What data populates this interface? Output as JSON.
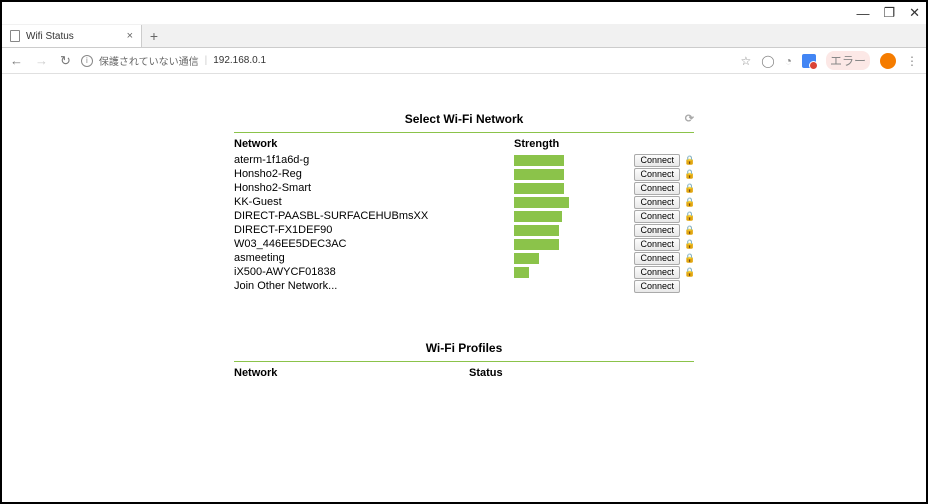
{
  "window": {
    "minimize": "—",
    "maximize": "❐",
    "close": "✕"
  },
  "tab": {
    "title": "Wifi Status",
    "close": "×",
    "new": "+"
  },
  "address": {
    "back": "←",
    "forward": "→",
    "reload": "↻",
    "info": "i",
    "unsecure_label": "保護されていない通信",
    "url": "192.168.0.1",
    "star": "☆",
    "browser": "◯",
    "chat": "◔",
    "error_badge": "エラー",
    "menu": "⋮"
  },
  "wifi": {
    "section_title": "Select Wi-Fi Network",
    "refresh_glyph": "⟳",
    "header_network": "Network",
    "header_strength": "Strength",
    "connect_label": "Connect",
    "lock_glyph": "🔒",
    "networks": [
      {
        "name": "aterm-1f1a6d-g",
        "strength": 50,
        "locked": true
      },
      {
        "name": "Honsho2-Reg",
        "strength": 50,
        "locked": true
      },
      {
        "name": "Honsho2-Smart",
        "strength": 50,
        "locked": true
      },
      {
        "name": "KK-Guest",
        "strength": 55,
        "locked": true
      },
      {
        "name": "DIRECT-PAASBL-SURFACEHUBmsXX",
        "strength": 48,
        "locked": true
      },
      {
        "name": "DIRECT-FX1DEF90",
        "strength": 45,
        "locked": true
      },
      {
        "name": "W03_446EE5DEC3AC",
        "strength": 45,
        "locked": true
      },
      {
        "name": "asmeeting",
        "strength": 25,
        "locked": true
      },
      {
        "name": "iX500-AWYCF01838",
        "strength": 15,
        "locked": true
      },
      {
        "name": "Join Other Network...",
        "strength": null,
        "locked": false
      }
    ]
  },
  "profiles": {
    "section_title": "Wi-Fi Profiles",
    "header_network": "Network",
    "header_status": "Status"
  }
}
